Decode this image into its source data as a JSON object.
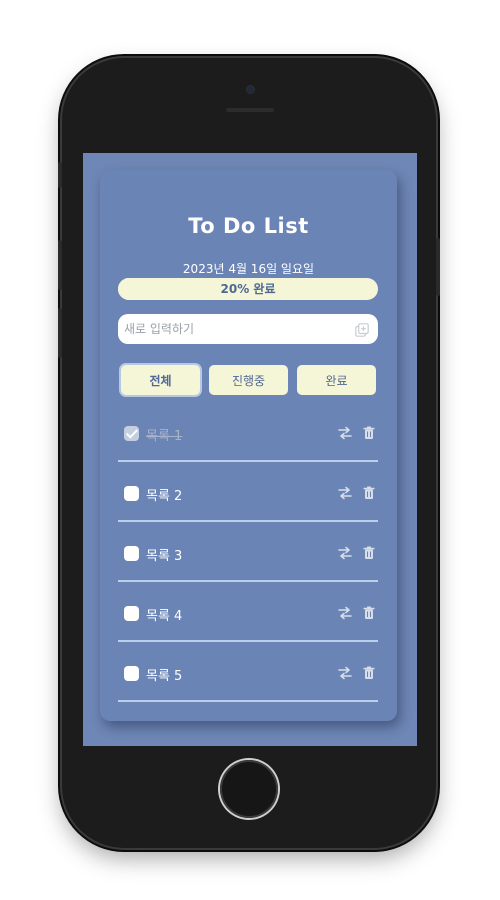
{
  "app": {
    "title": "To Do List",
    "date": "2023년 4월 16일 일요일"
  },
  "progress": {
    "label": "20% 완료",
    "fraction": 0.2
  },
  "new_item": {
    "placeholder": "새로 입력하기",
    "value": "",
    "add_icon": "add-copy-icon"
  },
  "filters": [
    {
      "label": "전체",
      "active": true
    },
    {
      "label": "진행중",
      "active": false
    },
    {
      "label": "완료",
      "active": false
    }
  ],
  "items": [
    {
      "label": "목록 1",
      "done": true
    },
    {
      "label": "목록 2",
      "done": false
    },
    {
      "label": "목록 3",
      "done": false
    },
    {
      "label": "목록 4",
      "done": false
    },
    {
      "label": "목록 5",
      "done": false
    }
  ],
  "icons": {
    "move": "swap-arrows-icon",
    "delete": "trash-icon"
  },
  "colors": {
    "background": "#6f87b6",
    "card": "#6a84b5",
    "accent": "#f5f6d8",
    "accent_text": "#4f6794",
    "divider": "#b9d0ea"
  }
}
